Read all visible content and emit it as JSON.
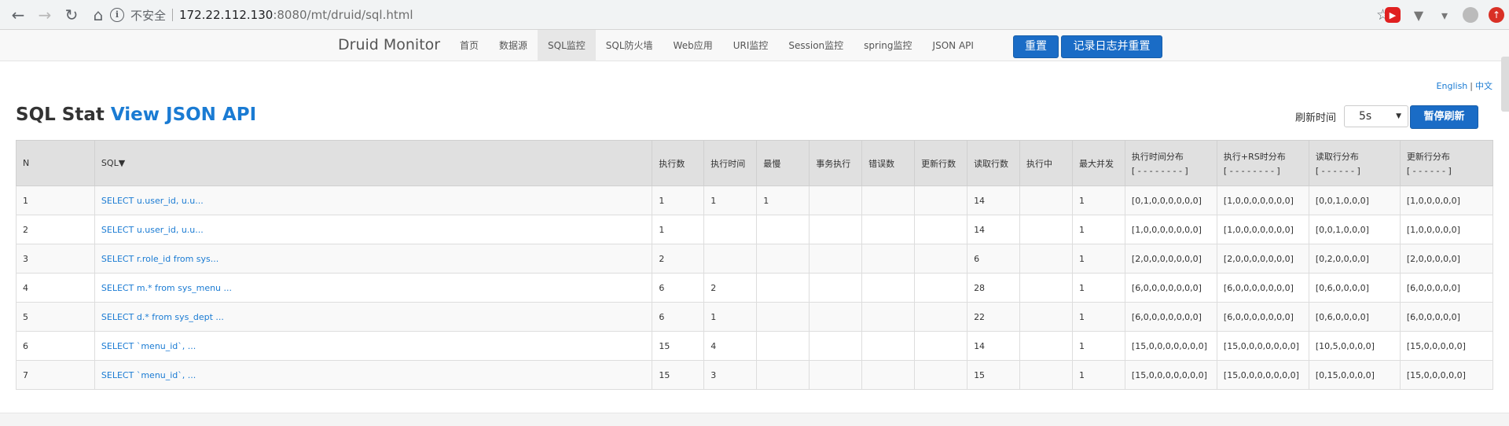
{
  "browser": {
    "insecure_label": "不安全",
    "url_host": "172.22.112.130",
    "url_rest": ":8080/mt/druid/sql.html"
  },
  "navbar": {
    "brand": "Druid Monitor",
    "items": [
      {
        "label": "首页",
        "active": false
      },
      {
        "label": "数据源",
        "active": false
      },
      {
        "label": "SQL监控",
        "active": true
      },
      {
        "label": "SQL防火墙",
        "active": false
      },
      {
        "label": "Web应用",
        "active": false
      },
      {
        "label": "URI监控",
        "active": false
      },
      {
        "label": "Session监控",
        "active": false
      },
      {
        "label": "spring监控",
        "active": false
      },
      {
        "label": "JSON API",
        "active": false
      }
    ],
    "reset_label": "重置",
    "log_reset_label": "记录日志并重置"
  },
  "lang": {
    "english": "English",
    "chinese": "中文",
    "separator": "|"
  },
  "title": {
    "main": "SQL Stat",
    "link": "View JSON API"
  },
  "refresh": {
    "label": "刷新时间",
    "selected": "5s",
    "pause_label": "暂停刷新"
  },
  "table": {
    "headers": [
      {
        "label": "N"
      },
      {
        "label": "SQL▼"
      },
      {
        "label": "执行数"
      },
      {
        "label": "执行时间"
      },
      {
        "label": "最慢"
      },
      {
        "label": "事务执行"
      },
      {
        "label": "错误数"
      },
      {
        "label": "更新行数"
      },
      {
        "label": "读取行数"
      },
      {
        "label": "执行中"
      },
      {
        "label": "最大并发"
      },
      {
        "label": "执行时间分布",
        "sub": "[ - - - - - - - - ]"
      },
      {
        "label": "执行+RS时分布",
        "sub": "[ - - - - - - - - ]"
      },
      {
        "label": "读取行分布",
        "sub": "[ - - - - - - ]"
      },
      {
        "label": "更新行分布",
        "sub": "[ - - - - - - ]"
      }
    ],
    "rows": [
      [
        "1",
        "SELECT u.user_id, u.u...",
        "1",
        "1",
        "1",
        "",
        "",
        "",
        "14",
        "",
        "1",
        "[0,1,0,0,0,0,0,0]",
        "[1,0,0,0,0,0,0,0]",
        "[0,0,1,0,0,0]",
        "[1,0,0,0,0,0]"
      ],
      [
        "2",
        "SELECT u.user_id, u.u...",
        "1",
        "",
        "",
        "",
        "",
        "",
        "14",
        "",
        "1",
        "[1,0,0,0,0,0,0,0]",
        "[1,0,0,0,0,0,0,0]",
        "[0,0,1,0,0,0]",
        "[1,0,0,0,0,0]"
      ],
      [
        "3",
        "SELECT r.role_id from sys...",
        "2",
        "",
        "",
        "",
        "",
        "",
        "6",
        "",
        "1",
        "[2,0,0,0,0,0,0,0]",
        "[2,0,0,0,0,0,0,0]",
        "[0,2,0,0,0,0]",
        "[2,0,0,0,0,0]"
      ],
      [
        "4",
        "SELECT m.* from sys_menu ...",
        "6",
        "2",
        "",
        "",
        "",
        "",
        "28",
        "",
        "1",
        "[6,0,0,0,0,0,0,0]",
        "[6,0,0,0,0,0,0,0]",
        "[0,6,0,0,0,0]",
        "[6,0,0,0,0,0]"
      ],
      [
        "5",
        "SELECT d.* from sys_dept ...",
        "6",
        "1",
        "",
        "",
        "",
        "",
        "22",
        "",
        "1",
        "[6,0,0,0,0,0,0,0]",
        "[6,0,0,0,0,0,0,0]",
        "[0,6,0,0,0,0]",
        "[6,0,0,0,0,0]"
      ],
      [
        "6",
        "SELECT `menu_id`, ...",
        "15",
        "4",
        "",
        "",
        "",
        "",
        "14",
        "",
        "1",
        "[15,0,0,0,0,0,0,0]",
        "[15,0,0,0,0,0,0,0]",
        "[10,5,0,0,0,0]",
        "[15,0,0,0,0,0]"
      ],
      [
        "7",
        "SELECT `menu_id`, ...",
        "15",
        "3",
        "",
        "",
        "",
        "",
        "15",
        "",
        "1",
        "[15,0,0,0,0,0,0,0]",
        "[15,0,0,0,0,0,0,0]",
        "[0,15,0,0,0,0]",
        "[15,0,0,0,0,0]"
      ]
    ]
  },
  "colors": {
    "link": "#1a7bd3",
    "primary_button": "#1a6cc6",
    "header_bg": "#e0e0e0"
  }
}
